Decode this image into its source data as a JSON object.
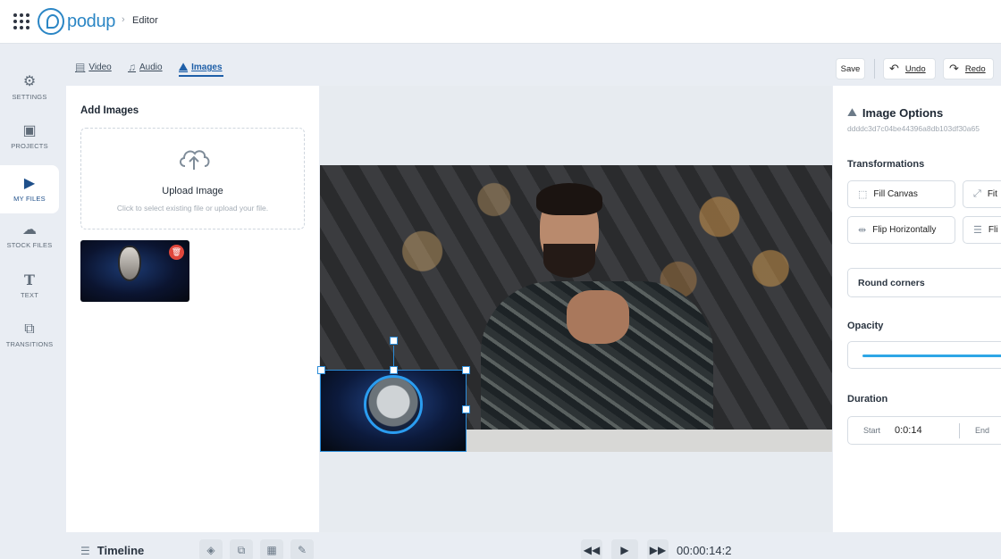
{
  "header": {
    "logo_text": "podup",
    "breadcrumb": "Editor"
  },
  "leftnav": [
    {
      "label": "SETTINGS",
      "icon": "gear-icon"
    },
    {
      "label": "PROJECTS",
      "icon": "projects-icon"
    },
    {
      "label": "MY FILES",
      "icon": "my-files-icon",
      "active": true
    },
    {
      "label": "STOCK FILES",
      "icon": "cloud-icon"
    },
    {
      "label": "TEXT",
      "icon": "text-icon"
    },
    {
      "label": "TRANSITIONS",
      "icon": "transitions-icon"
    }
  ],
  "tabs": [
    {
      "label": "Video",
      "icon": "video-icon"
    },
    {
      "label": "Audio",
      "icon": "audio-icon"
    },
    {
      "label": "Images",
      "icon": "image-icon",
      "active": true
    }
  ],
  "toolbar": {
    "save_label": "Save",
    "undo_label": "Undo",
    "redo_label": "Redo"
  },
  "images_panel": {
    "title": "Add Images",
    "upload_title": "Upload Image",
    "upload_hint": "Click to select existing file or upload your file."
  },
  "options": {
    "title": "Image Options",
    "image_id": "ddddc3d7c04be44396a8db103df30a65",
    "transformations_label": "Transformations",
    "buttons": [
      "Fill Canvas",
      "Fit",
      "Flip Horizontally",
      "Fli"
    ],
    "round_corners_label": "Round corners",
    "opacity_label": "Opacity",
    "opacity_value": 1.0,
    "duration_label": "Duration",
    "start_label": "Start",
    "start_value": "0:0:14",
    "end_label": "End"
  },
  "timeline": {
    "title": "Timeline",
    "time": "00:00:14:2"
  },
  "colors": {
    "accent": "#1e5fa8",
    "selection": "#2b8cd8",
    "slider": "#2ea6e6",
    "delete": "#e0473c"
  }
}
